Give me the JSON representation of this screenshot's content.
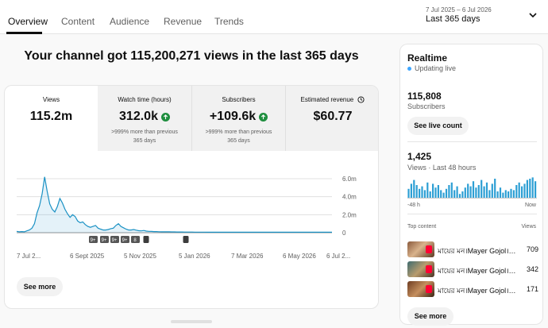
{
  "tabs": [
    {
      "label": "Overview",
      "active": true
    },
    {
      "label": "Content",
      "active": false
    },
    {
      "label": "Audience",
      "active": false
    },
    {
      "label": "Revenue",
      "active": false
    },
    {
      "label": "Trends",
      "active": false
    }
  ],
  "date_range": {
    "dates": "7 Jul 2025 – 6 Jul 2026",
    "label": "Last 365 days"
  },
  "headline": "Your channel got 115,200,271 views in the last 365 days",
  "metrics": [
    {
      "label": "Views",
      "value": "115.2m",
      "note": ""
    },
    {
      "label": "Watch time (hours)",
      "value": "312.0k",
      "note": ">999% more than previous 365 days"
    },
    {
      "label": "Subscribers",
      "value": "+109.6k",
      "note": ">999% more than previous 365 days"
    },
    {
      "label": "Estimated revenue",
      "value": "$60.77",
      "note": ""
    }
  ],
  "chart_data": {
    "type": "area",
    "series": [
      {
        "values": [
          0.15,
          0.1,
          0.12,
          0.1,
          0.2,
          0.3,
          0.5,
          1.0,
          2.2,
          3.0,
          4.3,
          6.2,
          4.6,
          3.2,
          2.6,
          2.3,
          2.9,
          3.8,
          3.3,
          2.6,
          2.1,
          1.7,
          2.0,
          1.8,
          1.3,
          1.1,
          1.2,
          0.9,
          0.7,
          0.6,
          0.7,
          0.8,
          0.5,
          0.4,
          0.3,
          0.3,
          0.35,
          0.45,
          0.5,
          0.8,
          1.0,
          0.7,
          0.55,
          0.4,
          0.3,
          0.3,
          0.35,
          0.28,
          0.22,
          0.2,
          0.25,
          0.18,
          0.15,
          0.14,
          0.12,
          0.12,
          0.11,
          0.1,
          0.1,
          0.1,
          0.1,
          0.09,
          0.09,
          0.08,
          0.08,
          0.08,
          0.07,
          0.07,
          0.07,
          0.07,
          0.06,
          0.06,
          0.06,
          0.06,
          0.06,
          0.05,
          0.05,
          0.05,
          0.05,
          0.05,
          0.05,
          0.05,
          0.05,
          0.05,
          0.05,
          0.05,
          0.05,
          0.05,
          0.05,
          0.05,
          0.05,
          0.05,
          0.05,
          0.05,
          0.05,
          0.05,
          0.05,
          0.05,
          0.05,
          0.05,
          0.05,
          0.05,
          0.05,
          0.05,
          0.05,
          0.05,
          0.05,
          0.05,
          0.05,
          0.05,
          0.05,
          0.05,
          0.05,
          0.05,
          0.05,
          0.05,
          0.05,
          0.05,
          0.05,
          0.05,
          0.05,
          0.05,
          0.05,
          0.05,
          0.05
        ]
      }
    ],
    "x_tick_labels": [
      "7 Jul 2...",
      "6 Sept 2025",
      "5 Nov 2025",
      "5 Jan 2026",
      "7 Mar 2026",
      "6 May 2026",
      "6 Jul 2..."
    ],
    "y_tick_labels": [
      "0",
      "2.0m",
      "4.0m",
      "6.0m"
    ],
    "ylim": [
      0,
      6.0
    ],
    "grid": true,
    "markers": [
      "9+",
      "9+",
      "9+",
      "9+",
      "8"
    ]
  },
  "see_more_label": "See more",
  "realtime": {
    "title": "Realtime",
    "live_text": "Updating live",
    "subscribers_value": "115,808",
    "subscribers_label": "Subscribers",
    "live_count_button": "See live count",
    "views_value": "1,425",
    "views_label": "Views · Last 48 hours",
    "bars": [
      0.35,
      0.55,
      0.7,
      0.5,
      0.35,
      0.45,
      0.3,
      0.6,
      0.25,
      0.55,
      0.4,
      0.5,
      0.3,
      0.2,
      0.35,
      0.5,
      0.6,
      0.3,
      0.45,
      0.15,
      0.25,
      0.4,
      0.55,
      0.45,
      0.65,
      0.4,
      0.5,
      0.7,
      0.45,
      0.6,
      0.3,
      0.55,
      0.75,
      0.25,
      0.4,
      0.2,
      0.3,
      0.25,
      0.35,
      0.3,
      0.5,
      0.6,
      0.45,
      0.55,
      0.7,
      0.75,
      0.8,
      0.65
    ],
    "axis_left": "-48 h",
    "axis_right": "Now",
    "top_content_label": "Top content",
    "views_col_label": "Views",
    "top_content": [
      {
        "title": "মায়ের মন।Mayer Gojol।Bangla Islamic",
        "views": "709"
      },
      {
        "title": "মায়ের মন।Mayer Gojol।Bangla Islamic",
        "views": "342"
      },
      {
        "title": "মায়ের মন।Mayer Gojol।Bangla Islamic",
        "views": "171"
      }
    ],
    "see_more": "See more"
  }
}
